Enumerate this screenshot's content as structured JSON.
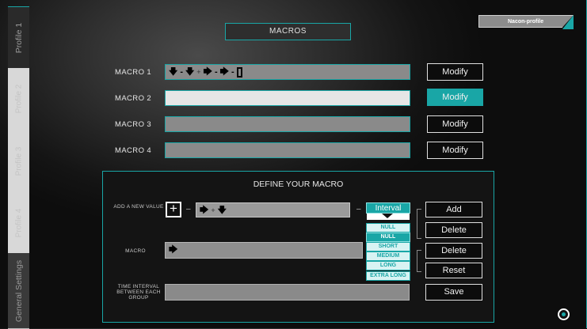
{
  "sidebar": {
    "profile1": "Profile 1",
    "profile2": "Profile 2",
    "profile3": "Profile 3",
    "profile4": "Profile 4",
    "general": "General Settings"
  },
  "header": {
    "title": "MACROS",
    "profile_badge": "Nacon-profile"
  },
  "macros": [
    {
      "label": "MACRO 1",
      "button": "Modify"
    },
    {
      "label": "MACRO 2",
      "button": "Modify"
    },
    {
      "label": "MACRO 3",
      "button": "Modify"
    },
    {
      "label": "MACRO 4",
      "button": "Modify"
    }
  ],
  "define": {
    "title": "DEFINE YOUR MACRO",
    "add_value_label": "ADD A NEW VALUE",
    "macro_label": "MACRO",
    "interval_label": "TIME INTERVAL BETWEEN EACH GROUP",
    "plus": "+",
    "connector_dash": "–",
    "add_button": "Add",
    "delete_button": "Delete",
    "delete_button_2": "Delete",
    "reset_button": "Reset",
    "save_button": "Save",
    "interval_dropdown": {
      "selected": "Interval",
      "options": [
        "NULL",
        "NULL",
        "SHORT",
        "MEDIUM",
        "LONG",
        "EXTRA LONG"
      ]
    }
  },
  "accent_color": "#19a6a6"
}
